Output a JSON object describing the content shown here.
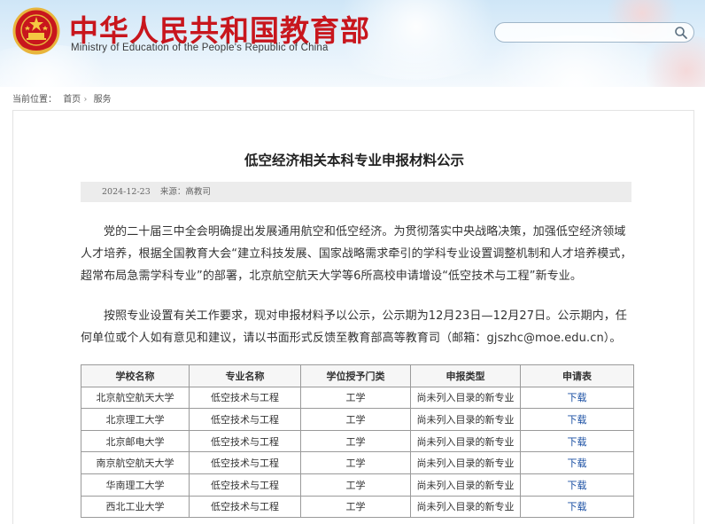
{
  "header": {
    "title_cn": "中华人民共和国教育部",
    "title_en": "Ministry of Education of the People's Republic of China",
    "emblem_icon": "national-emblem-icon",
    "search": {
      "placeholder": "",
      "icon": "search-icon"
    },
    "colors": {
      "title": "#c8161d",
      "sky": "#cfe6f7"
    }
  },
  "breadcrumb": {
    "label": "当前位置：",
    "items": [
      "首页",
      "服务"
    ],
    "separator": "›"
  },
  "article": {
    "title": "低空经济相关本科专业申报材料公示",
    "date": "2024-12-23",
    "source": "来源：高教司",
    "paragraphs": [
      "党的二十届三中全会明确提出发展通用航空和低空经济。为贯彻落实中央战略决策，加强低空经济领域人才培养，根据全国教育大会“建立科技发展、国家战略需求牵引的学科专业设置调整机制和人才培养模式，超常布局急需学科专业”的部署，北京航空航天大学等6所高校申请增设“低空技术与工程”新专业。",
      "按照专业设置有关工作要求，现对申报材料予以公示，公示期为12月23日—12月27日。公示期内，任何单位或个人如有意见和建议，请以书面形式反馈至教育部高等教育司（邮箱：gjszhc@moe.edu.cn）。"
    ]
  },
  "table": {
    "headers": [
      "学校名称",
      "专业名称",
      "学位授予门类",
      "申报类型",
      "申请表"
    ],
    "rows": [
      [
        "北京航空航天大学",
        "低空技术与工程",
        "工学",
        "尚未列入目录的新专业",
        "下载"
      ],
      [
        "北京理工大学",
        "低空技术与工程",
        "工学",
        "尚未列入目录的新专业",
        "下载"
      ],
      [
        "北京邮电大学",
        "低空技术与工程",
        "工学",
        "尚未列入目录的新专业",
        "下载"
      ],
      [
        "南京航空航天大学",
        "低空技术与工程",
        "工学",
        "尚未列入目录的新专业",
        "下载"
      ],
      [
        "华南理工大学",
        "低空技术与工程",
        "工学",
        "尚未列入目录的新专业",
        "下载"
      ],
      [
        "西北工业大学",
        "低空技术与工程",
        "工学",
        "尚未列入目录的新专业",
        "下载"
      ]
    ],
    "link_color": "#1a4fa3"
  }
}
